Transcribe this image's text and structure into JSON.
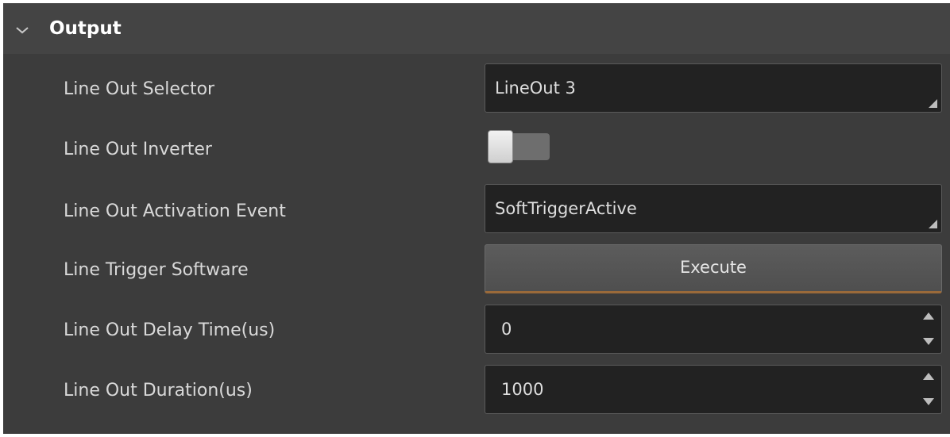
{
  "section": {
    "title": "Output",
    "expand_icon": "chevron-down-icon"
  },
  "rows": {
    "line_out_selector": {
      "label": "Line Out Selector",
      "value": "LineOut 3"
    },
    "line_out_inverter": {
      "label": "Line Out Inverter",
      "state": "off"
    },
    "line_out_activation_event": {
      "label": "Line Out Activation Event",
      "value": "SoftTriggerActive"
    },
    "line_trigger_software": {
      "label": "Line Trigger Software",
      "button_label": "Execute"
    },
    "line_out_delay_time": {
      "label": "Line Out Delay Time(us)",
      "value": "0"
    },
    "line_out_duration": {
      "label": "Line Out Duration(us)",
      "value": "1000"
    }
  },
  "colors": {
    "panel_background": "#3c3c3c",
    "header_background": "#444444",
    "field_background": "#222222",
    "button_accent": "#9a6a3a"
  }
}
